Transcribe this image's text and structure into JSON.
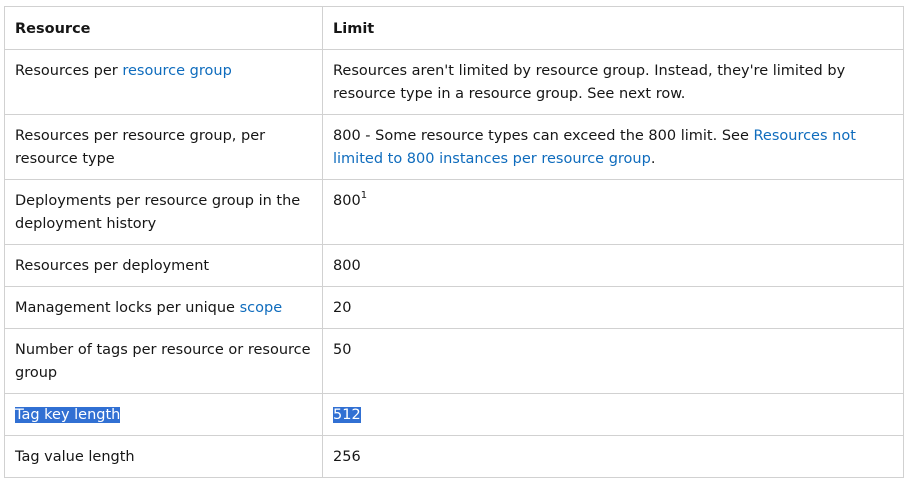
{
  "headers": {
    "resource": "Resource",
    "limit": "Limit"
  },
  "rows": [
    {
      "resource_prefix": "Resources per ",
      "resource_link": "resource group",
      "limit_text": "Resources aren't limited by resource group. Instead, they're limited by resource type in a resource group. See next row."
    },
    {
      "resource_text": "Resources per resource group, per resource type",
      "limit_prefix": "800 - Some resource types can exceed the 800 limit. See ",
      "limit_link": "Resources not limited to 800 instances per resource group",
      "limit_suffix": "."
    },
    {
      "resource_text": "Deployments per resource group in the deployment history",
      "limit_text": "800",
      "limit_footnote": "1"
    },
    {
      "resource_text": "Resources per deployment",
      "limit_text": "800"
    },
    {
      "resource_prefix": "Management locks per unique ",
      "resource_link": "scope",
      "limit_text": "20"
    },
    {
      "resource_text": "Number of tags per resource or resource group",
      "limit_text": "50"
    },
    {
      "resource_text": "Tag key length",
      "limit_text": "512",
      "selected": true
    },
    {
      "resource_text": "Tag value length",
      "limit_text": "256"
    }
  ],
  "colors": {
    "link": "#0f6cbd",
    "selection": "#3170d3",
    "border": "#d1d1d1"
  }
}
